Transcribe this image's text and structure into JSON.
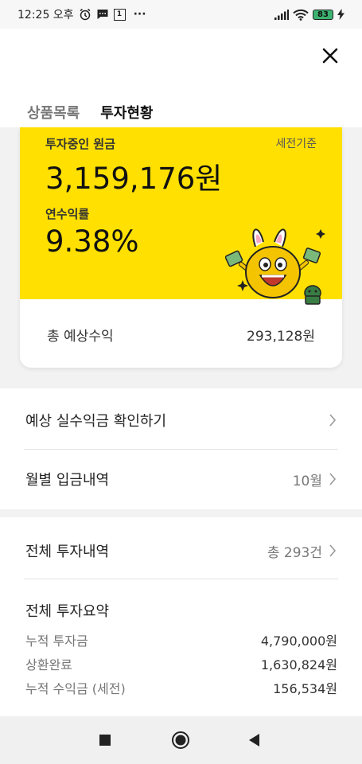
{
  "status_bar": {
    "time": "12:25 오후",
    "calendar_day": "1",
    "more": "···",
    "battery": "83"
  },
  "tabs": [
    {
      "label": "상품목록",
      "active": false
    },
    {
      "label": "투자현황",
      "active": true
    }
  ],
  "card": {
    "principal_label": "투자중인 원금",
    "tax_note": "세전기준",
    "principal_value": "3,159,176원",
    "rate_label": "연수익률",
    "rate_value": "9.38%",
    "expected_label": "총 예상수익",
    "expected_value": "293,128원"
  },
  "rows": {
    "net_profit": {
      "label": "예상 실수익금 확인하기"
    },
    "monthly_deposit": {
      "label": "월별 입금내역",
      "value": "10월"
    },
    "all_investments": {
      "label": "전체 투자내역",
      "value": "총 293건"
    }
  },
  "summary": {
    "title": "전체 투자요약",
    "items": [
      {
        "label": "누적 투자금",
        "value": "4,790,000원"
      },
      {
        "label": "상환완료",
        "value": "1,630,824원"
      },
      {
        "label": "누적 수익금 (세전)",
        "value": "156,534원"
      }
    ]
  },
  "colors": {
    "accent_yellow": "#ffe000",
    "battery_green": "#3cb371"
  },
  "icons": [
    "alarm-icon",
    "message-icon",
    "calendar-icon",
    "signal-icon",
    "wifi-icon",
    "battery-icon",
    "charging-icon",
    "close-icon",
    "chevron-right-icon",
    "stop-icon",
    "home-icon",
    "back-icon"
  ]
}
